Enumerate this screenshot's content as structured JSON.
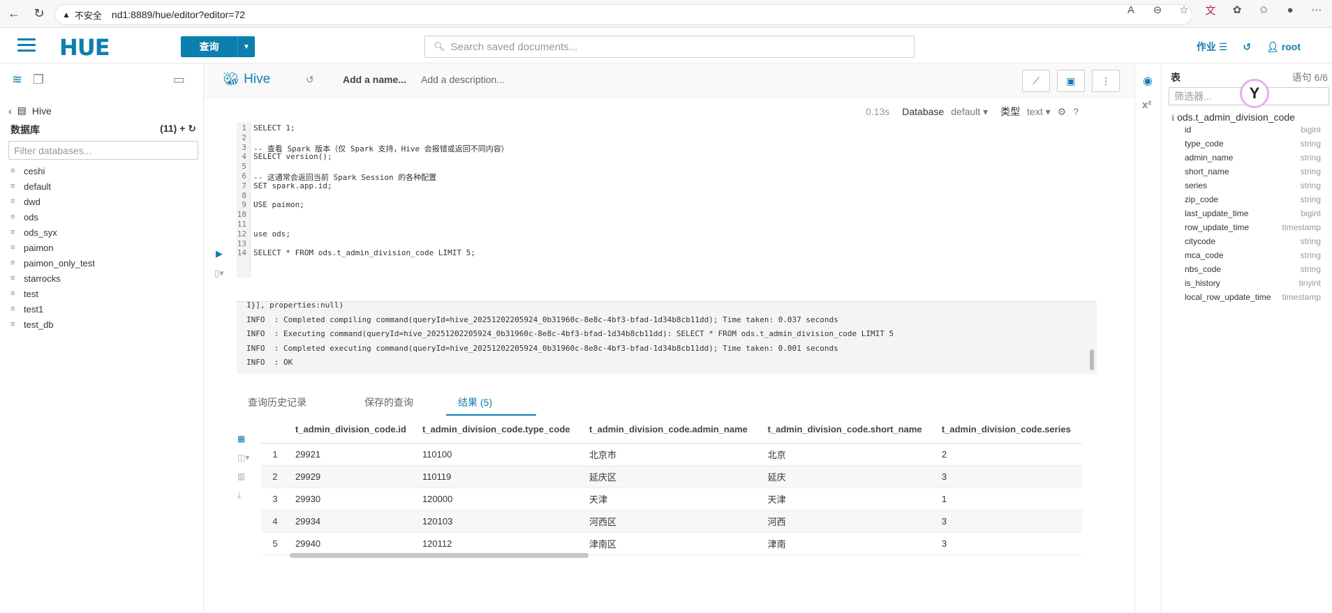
{
  "browser": {
    "insecure_label": "不安全",
    "url": "nd1:8889/hue/editor?editor=72",
    "ext_badge": "文"
  },
  "header": {
    "logo": "HUE",
    "query_button": "查询",
    "search_placeholder": "Search saved documents...",
    "jobs_label": "作业",
    "user_label": "root"
  },
  "left_panel": {
    "breadcrumb": "Hive",
    "db_header": "数据库",
    "db_count": "(11)",
    "filter_placeholder": "Filter databases...",
    "databases": [
      "ceshi",
      "default",
      "dwd",
      "ods",
      "ods_syx",
      "paimon",
      "paimon_only_test",
      "starrocks",
      "test",
      "test1",
      "test_db"
    ]
  },
  "editor": {
    "type": "Hive",
    "name_placeholder": "Add a name...",
    "desc_placeholder": "Add a description...",
    "time": "0.13s",
    "database_label": "Database",
    "database_value": "default",
    "type_label": "类型",
    "type_value": "text",
    "help": "?",
    "lines": [
      "SELECT 1;",
      "",
      "-- 查看 Spark 版本（仅 Spark 支持，Hive 会报错或返回不同内容）",
      "SELECT version();",
      "",
      "-- 这通常会返回当前 Spark Session 的各种配置",
      "SET spark.app.id;",
      "",
      "USE paimon;",
      "",
      "",
      "use ods;",
      "",
      "SELECT * FROM ods.t_admin_division_code LIMIT 5;"
    ]
  },
  "log": [
    "1}], properties:null)",
    "INFO  : Completed compiling command(queryId=hive_20251202205924_0b31960c-8e8c-4bf3-bfad-1d34b8cb11dd); Time taken: 0.037 seconds",
    "INFO  : Executing command(queryId=hive_20251202205924_0b31960c-8e8c-4bf3-bfad-1d34b8cb11dd): SELECT * FROM ods.t_admin_division_code LIMIT 5",
    "INFO  : Completed executing command(queryId=hive_20251202205924_0b31960c-8e8c-4bf3-bfad-1d34b8cb11dd); Time taken: 0.001 seconds",
    "INFO  : OK"
  ],
  "tabs": [
    "查询历史记录",
    "保存的查询",
    "结果 (5)"
  ],
  "results": {
    "columns": [
      "t_admin_division_code.id",
      "t_admin_division_code.type_code",
      "t_admin_division_code.admin_name",
      "t_admin_division_code.short_name",
      "t_admin_division_code.series"
    ],
    "rows": [
      [
        "1",
        "29921",
        "110100",
        "北京市",
        "北京",
        "2"
      ],
      [
        "2",
        "29929",
        "110119",
        "延庆区",
        "延庆",
        "3"
      ],
      [
        "3",
        "29930",
        "120000",
        "天津",
        "天津",
        "1"
      ],
      [
        "4",
        "29934",
        "120103",
        "河西区",
        "河西",
        "3"
      ],
      [
        "5",
        "29940",
        "120112",
        "津南区",
        "津南",
        "3"
      ]
    ]
  },
  "right_panel": {
    "title": "表",
    "statement": "语句 6/6",
    "filter_placeholder": "筛选器...",
    "table_name": "ods.t_admin_division_code",
    "columns": [
      {
        "name": "id",
        "type": "bigint"
      },
      {
        "name": "type_code",
        "type": "string"
      },
      {
        "name": "admin_name",
        "type": "string"
      },
      {
        "name": "short_name",
        "type": "string"
      },
      {
        "name": "series",
        "type": "string"
      },
      {
        "name": "zip_code",
        "type": "string"
      },
      {
        "name": "last_update_time",
        "type": "bigint"
      },
      {
        "name": "row_update_time",
        "type": "timestamp"
      },
      {
        "name": "citycode",
        "type": "string"
      },
      {
        "name": "mca_code",
        "type": "string"
      },
      {
        "name": "nbs_code",
        "type": "string"
      },
      {
        "name": "is_history",
        "type": "tinyint"
      },
      {
        "name": "local_row_update_time",
        "type": "timestamp"
      }
    ]
  }
}
